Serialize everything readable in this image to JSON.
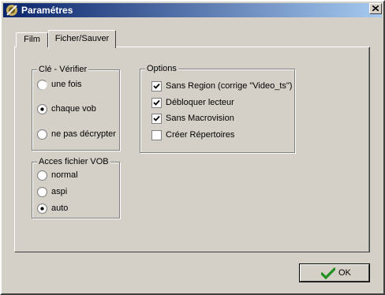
{
  "window": {
    "title": "Paramétres",
    "icon": "app-icon",
    "close_icon": "close-icon"
  },
  "tabs": [
    {
      "label": "Film",
      "selected": false
    },
    {
      "label": "Ficher/Sauver",
      "selected": true
    }
  ],
  "cle_verifier": {
    "title": "Clé - Vérifier",
    "options": [
      {
        "label": "une fois",
        "selected": false
      },
      {
        "label": "chaque vob",
        "selected": true
      },
      {
        "label": "ne pas décrypter",
        "selected": false
      }
    ]
  },
  "acces_vob": {
    "title": "Acces fichier VOB",
    "options": [
      {
        "label": "normal",
        "selected": false
      },
      {
        "label": "aspi",
        "selected": false
      },
      {
        "label": "auto",
        "selected": true
      }
    ]
  },
  "options_group": {
    "title": "Options",
    "items": [
      {
        "label": "Sans Region (corrige \"Video_ts\")",
        "checked": true
      },
      {
        "label": "Débloquer lecteur",
        "checked": true
      },
      {
        "label": "Sans Macrovision",
        "checked": true
      },
      {
        "label": "Créer Répertoires",
        "checked": false
      }
    ]
  },
  "ok_button": {
    "label": "OK",
    "icon": "check-icon",
    "icon_color": "#1f8f1f"
  },
  "colors": {
    "face": "#d4d0c8",
    "title_start": "#0a246a",
    "title_end": "#a6caf0"
  }
}
